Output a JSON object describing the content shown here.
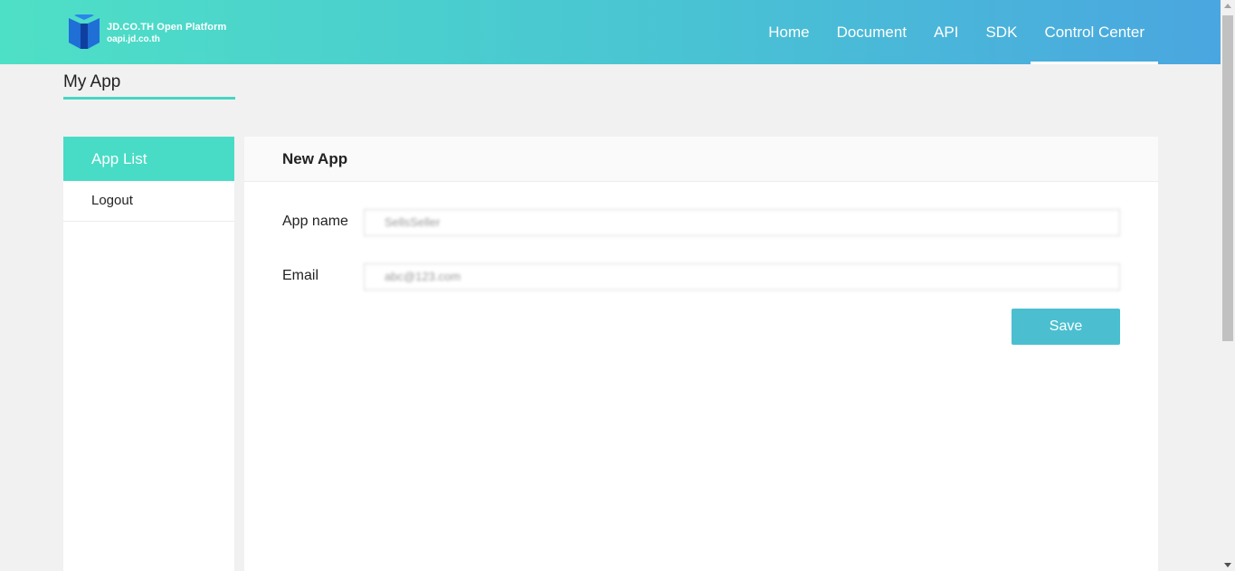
{
  "header": {
    "brand_title": "JD.CO.TH Open Platform",
    "brand_subtitle": "oapi.jd.co.th",
    "logo_icon": "book-cube-icon",
    "nav": [
      {
        "label": "Home",
        "active": false
      },
      {
        "label": "Document",
        "active": false
      },
      {
        "label": "API",
        "active": false
      },
      {
        "label": "SDK",
        "active": false
      },
      {
        "label": "Control Center",
        "active": true
      }
    ]
  },
  "page": {
    "title": "My App"
  },
  "sidebar": {
    "items": [
      {
        "label": "App List",
        "active": true
      },
      {
        "label": "Logout",
        "active": false
      }
    ]
  },
  "form": {
    "heading": "New App",
    "app_name_label": "App name",
    "app_name_value": "SellsSeller",
    "email_label": "Email",
    "email_value": "abc@123.com",
    "save_label": "Save"
  },
  "colors": {
    "accent": "#48dcc6",
    "button": "#4bbfd0"
  }
}
